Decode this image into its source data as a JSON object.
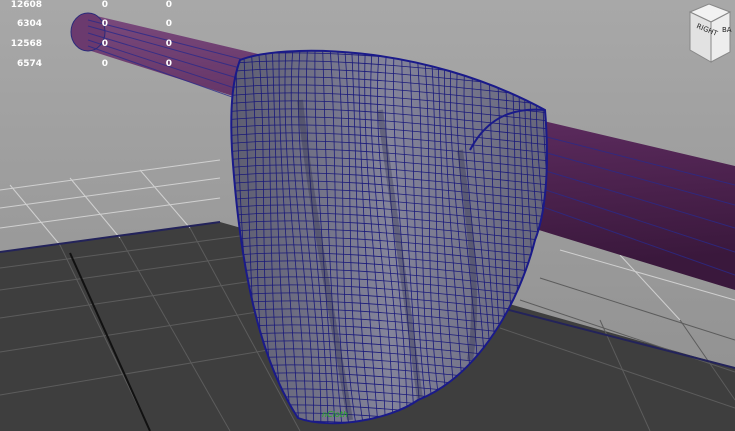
{
  "hud": {
    "rows": [
      {
        "a": "12608",
        "b": "0",
        "c": "0"
      },
      {
        "a": "6304",
        "b": "0",
        "c": "0"
      },
      {
        "a": "12568",
        "b": "0",
        "c": "0"
      },
      {
        "a": "6574",
        "b": "0",
        "c": "0"
      }
    ]
  },
  "viewcube": {
    "face_right": "RIGHT",
    "face_back": "BA"
  },
  "object_label": "nCloth",
  "colors": {
    "background": "#9e9e9e",
    "grid_floor": "#3e3e3e",
    "grid_line": "#5a5a5a",
    "grid_line_light": "#d6d6d6",
    "pole": "#5a2a5c",
    "cloth": "#76768a",
    "wireframe": "#16167a",
    "hud_text": "#ffffff",
    "selection_label": "#1fae1f"
  }
}
